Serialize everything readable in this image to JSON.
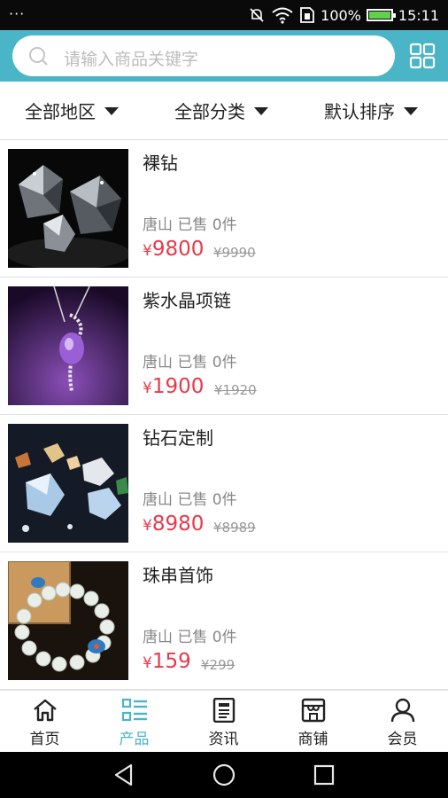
{
  "status_bar": {
    "dots": "···",
    "battery_text": "100%",
    "battery_level": 1.0,
    "time": "15:11",
    "icons": [
      "mute-icon",
      "wifi-icon",
      "sim-icon",
      "battery-icon"
    ]
  },
  "header": {
    "search_placeholder": "请输入商品关键字",
    "accent_color": "#4ab5c7"
  },
  "filters": [
    {
      "label": "全部地区"
    },
    {
      "label": "全部分类"
    },
    {
      "label": "默认排序"
    }
  ],
  "products": [
    {
      "name": "裸钻",
      "meta": "唐山 已售 0件",
      "currency": "¥",
      "price": "9800",
      "old_price": "¥9990"
    },
    {
      "name": "紫水晶项链",
      "meta": "唐山 已售 0件",
      "currency": "¥",
      "price": "1900",
      "old_price": "¥1920"
    },
    {
      "name": "钻石定制",
      "meta": "唐山 已售 0件",
      "currency": "¥",
      "price": "8980",
      "old_price": "¥8989"
    },
    {
      "name": "珠串首饰",
      "meta": "唐山 已售 0件",
      "currency": "¥",
      "price": "159",
      "old_price": "¥299"
    }
  ],
  "tabbar": {
    "active": "产品",
    "tabs": [
      {
        "label": "首页",
        "icon": "home-icon"
      },
      {
        "label": "产品",
        "icon": "list-icon"
      },
      {
        "label": "资讯",
        "icon": "news-icon"
      },
      {
        "label": "商铺",
        "icon": "shop-icon"
      },
      {
        "label": "会员",
        "icon": "user-icon"
      }
    ]
  },
  "colors": {
    "price": "#e8394b",
    "accent": "#4ab5c7"
  }
}
